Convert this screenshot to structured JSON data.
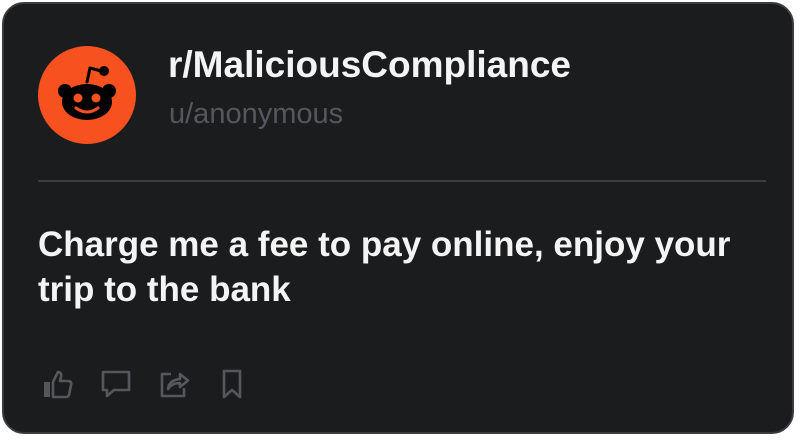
{
  "post": {
    "subreddit": "r/MaliciousCompliance",
    "author": "u/anonymous",
    "title": "Charge me a fee to pay online, enjoy your trip to the bank"
  },
  "icons": {
    "avatar": "reddit-snoo-icon",
    "actions": [
      "thumbs-up-icon",
      "comment-icon",
      "share-icon",
      "bookmark-icon"
    ]
  },
  "colors": {
    "card_background": "#1b1c1e",
    "avatar_background": "#f6511f",
    "title_text": "#f4f4f4",
    "muted_text": "#55575c",
    "icon": "#55575c"
  }
}
